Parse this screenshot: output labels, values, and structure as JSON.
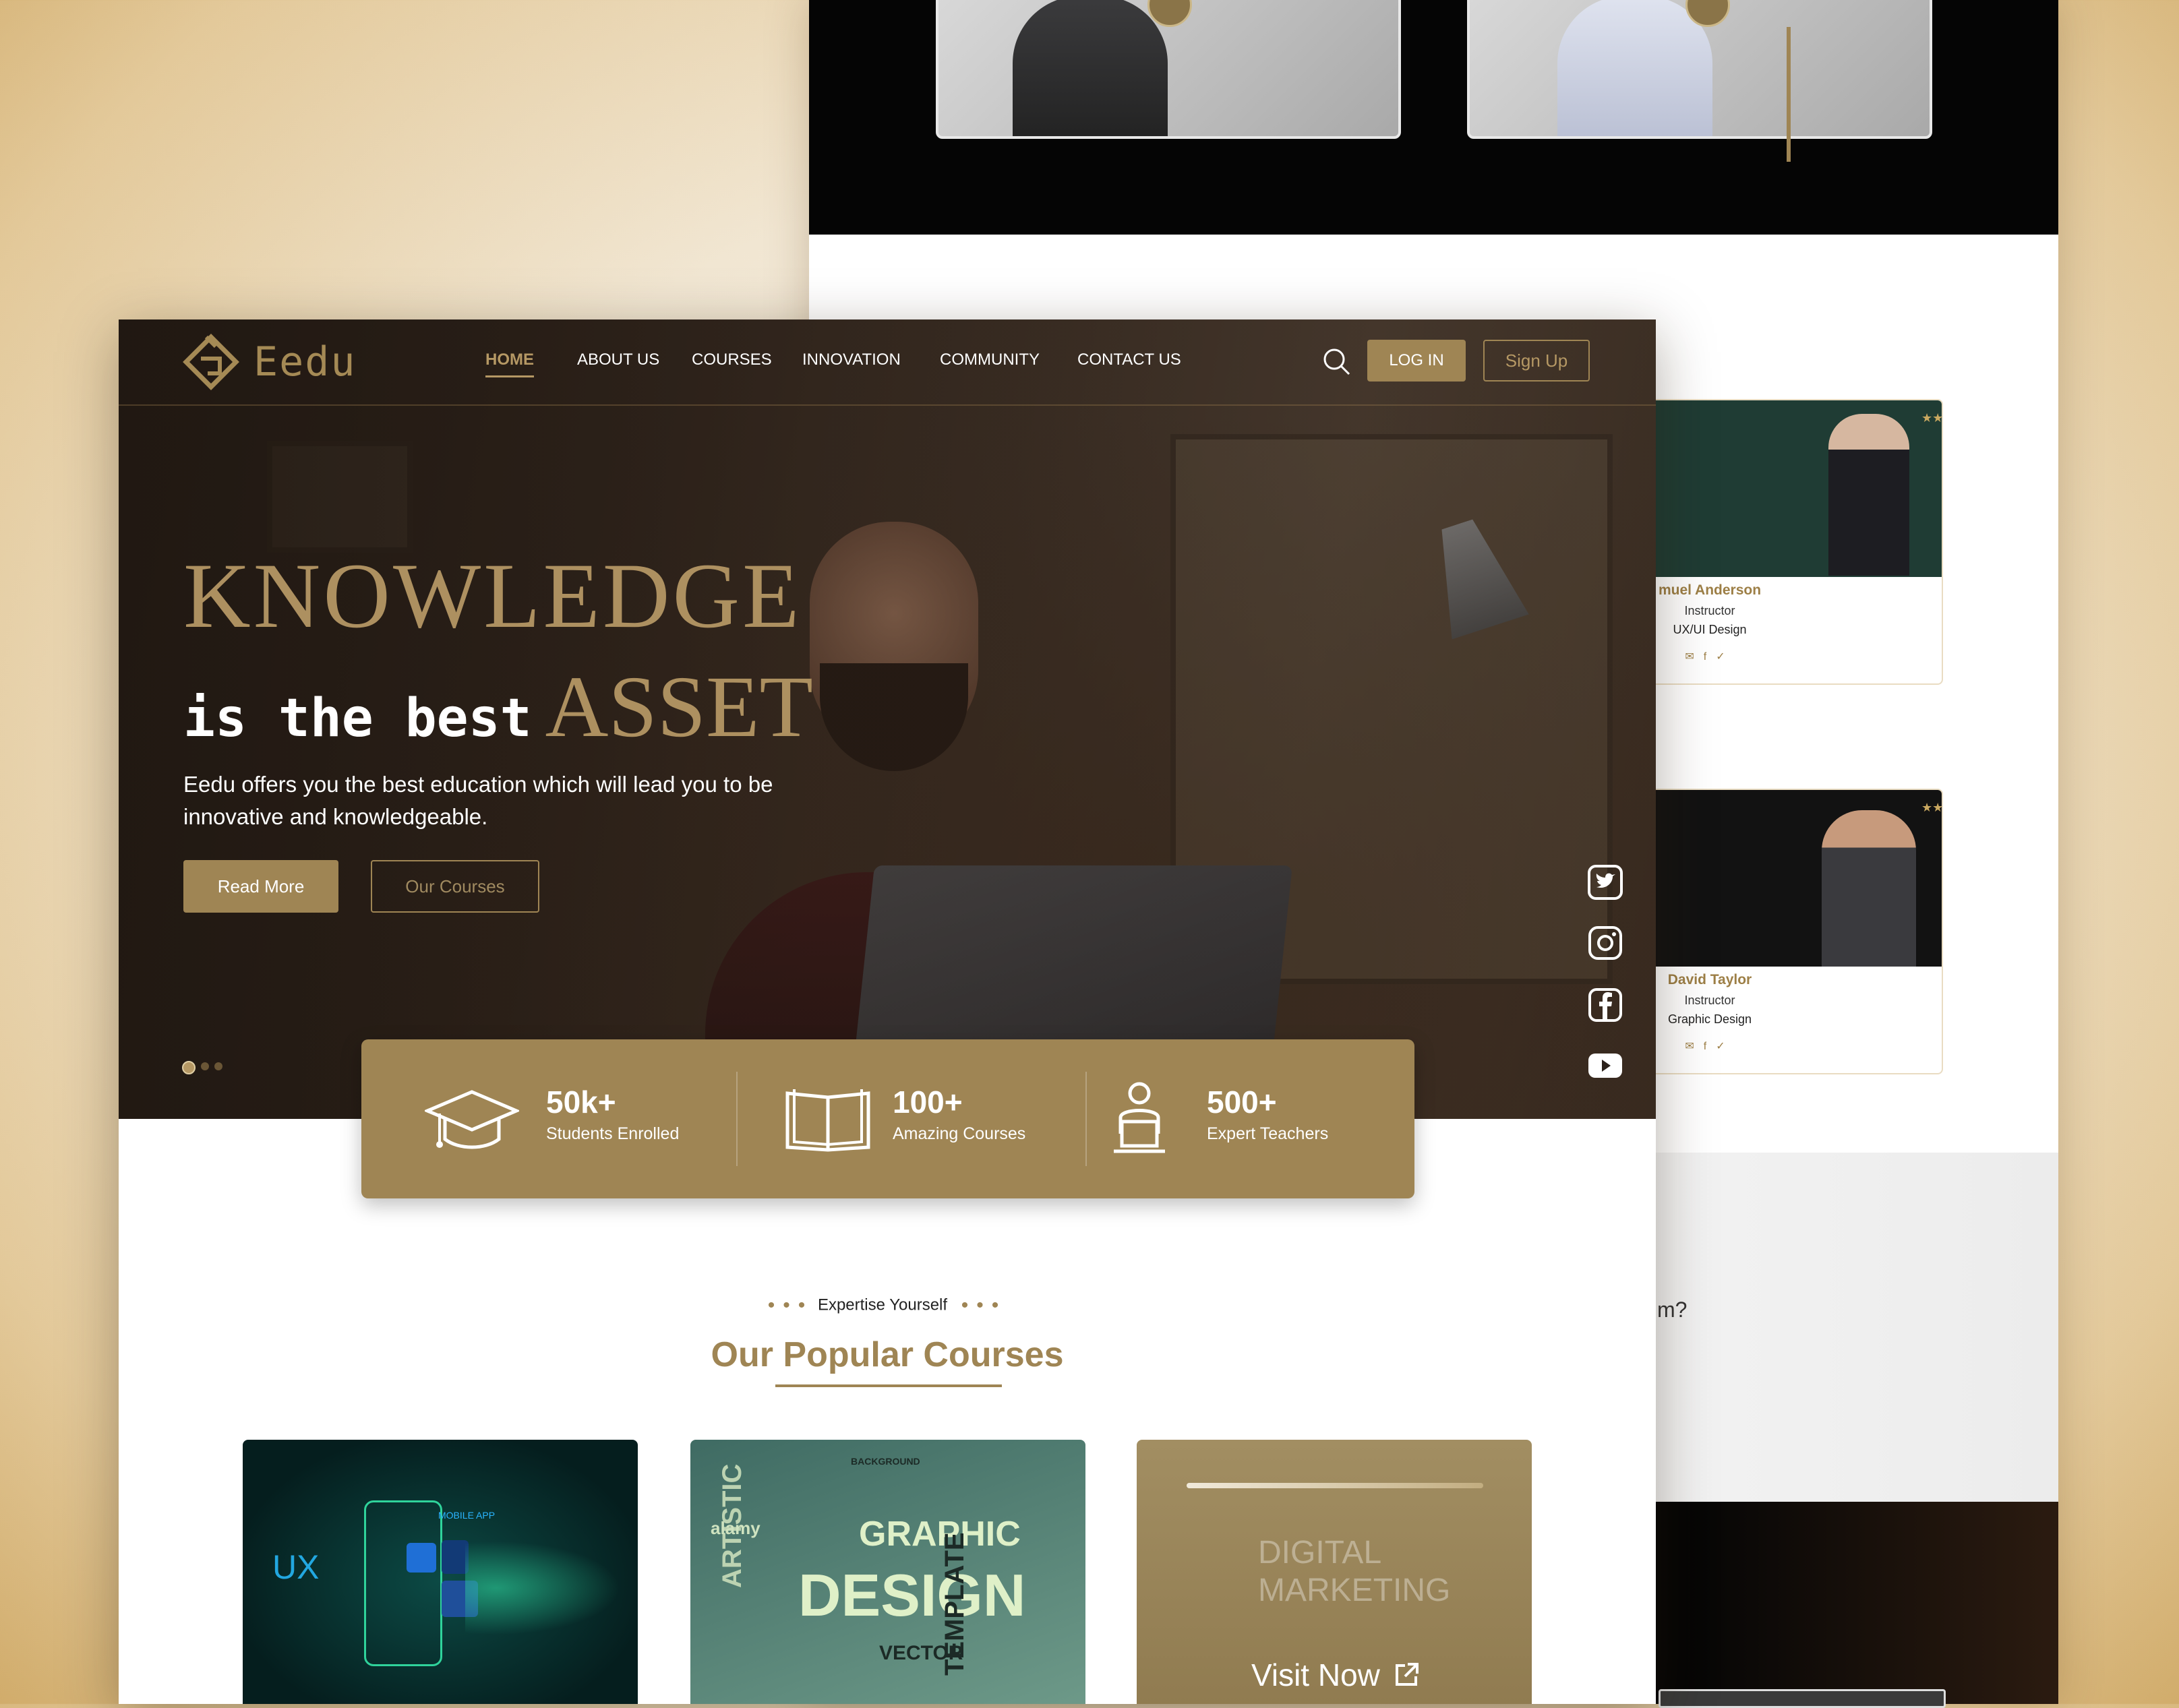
{
  "navbar": {
    "logo_text": "Eedu",
    "items": [
      {
        "label": "HOME",
        "active": true
      },
      {
        "label": "ABOUT US"
      },
      {
        "label": "COURSES"
      },
      {
        "label": "INNOVATION"
      },
      {
        "label": "COMMUNITY"
      },
      {
        "label": "CONTACT US"
      }
    ],
    "login_label": "LOG IN",
    "signup_label": "Sign Up"
  },
  "hero": {
    "line1": "KNOWLEDGE",
    "line2_prefix": "is the best",
    "line2_highlight": "ASSET",
    "description": "Eedu offers you the best education which will lead you to be innovative and knowledgeable.",
    "read_more_label": "Read More",
    "our_courses_label": "Our Courses"
  },
  "social": [
    "twitter-icon",
    "instagram-icon",
    "facebook-icon",
    "youtube-icon"
  ],
  "stats": [
    {
      "value": "50k+",
      "label": "Students Enrolled",
      "icon": "graduation-cap-icon"
    },
    {
      "value": "100+",
      "label": "Amazing Courses",
      "icon": "open-book-icon"
    },
    {
      "value": "500+",
      "label": "Expert Teachers",
      "icon": "teacher-icon"
    }
  ],
  "courses_section": {
    "kicker": "Expertise Yourself",
    "title": "Our Popular Courses"
  },
  "course_cards": {
    "ux": {
      "big": "UX",
      "tag": "MOBILE APP"
    },
    "graphic": {
      "word1": "GRAPHIC",
      "word2": "DESIGN",
      "word3": "ARTISTIC",
      "word4": "TEMPLATE",
      "word5": "BACKGROUND",
      "word6": "VECTOR",
      "word7": "alamy"
    },
    "digital": {
      "line1": "DIGITAL",
      "line2": "MARKETING",
      "visit": "Visit Now"
    }
  },
  "background_page": {
    "teachers": [
      {
        "name": "muel Anderson",
        "role": "Instructor",
        "dept": "UX/UI Design"
      },
      {
        "name": "David Taylor",
        "role": "Instructor",
        "dept": "Graphic Design"
      }
    ],
    "question_fragment": "m?"
  },
  "colors": {
    "gold": "#9f8554",
    "gold_light": "#b59864",
    "hero_dark": "#2b211a"
  }
}
